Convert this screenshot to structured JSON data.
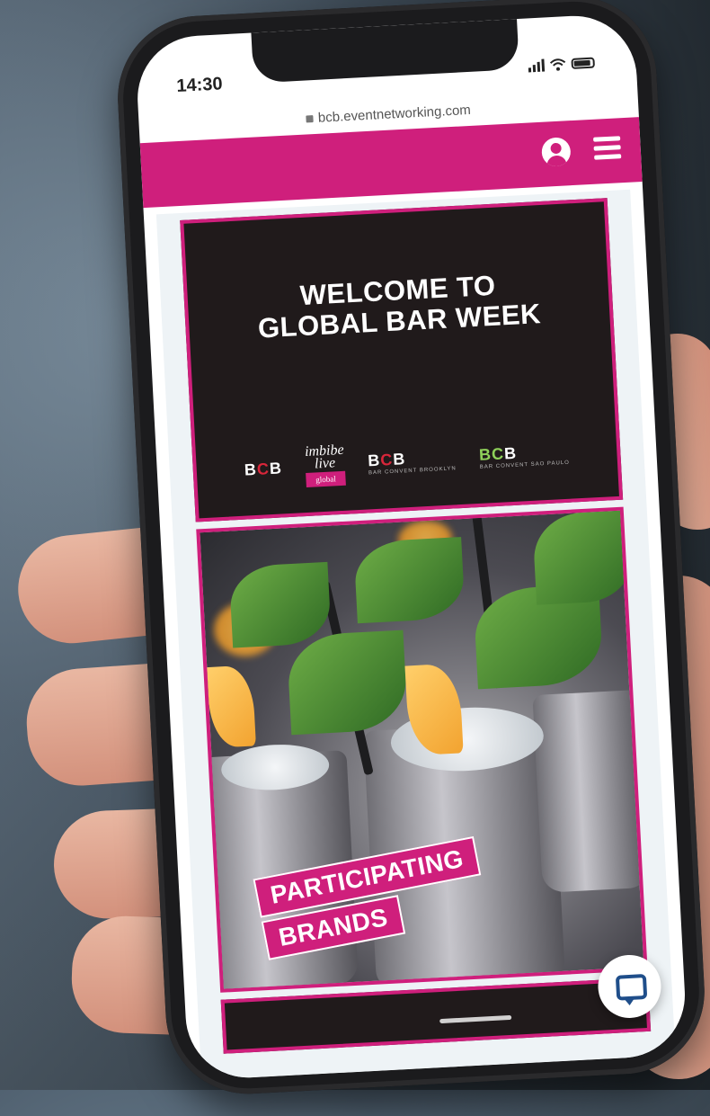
{
  "status_bar": {
    "time": "14:30"
  },
  "browser": {
    "url": "bcb.eventnetworking.com"
  },
  "header": {
    "brand_color": "#cf1f7c",
    "icons": [
      "user-icon",
      "menu-icon"
    ]
  },
  "hero": {
    "title_line1": "WELCOME TO",
    "title_line2": "GLOBAL BAR WEEK",
    "logos": [
      {
        "name": "BCB"
      },
      {
        "name": "imbibe live",
        "tag": "global"
      },
      {
        "name": "BCB",
        "subtitle": "BAR CONVENT BROOKLYN"
      },
      {
        "name": "BCB",
        "subtitle": "BAR CONVENT SAO PAULO"
      }
    ]
  },
  "feature": {
    "label_line1": "PARTICIPATING",
    "label_line2": "BRANDS"
  },
  "chat": {
    "icon": "chat-icon"
  }
}
